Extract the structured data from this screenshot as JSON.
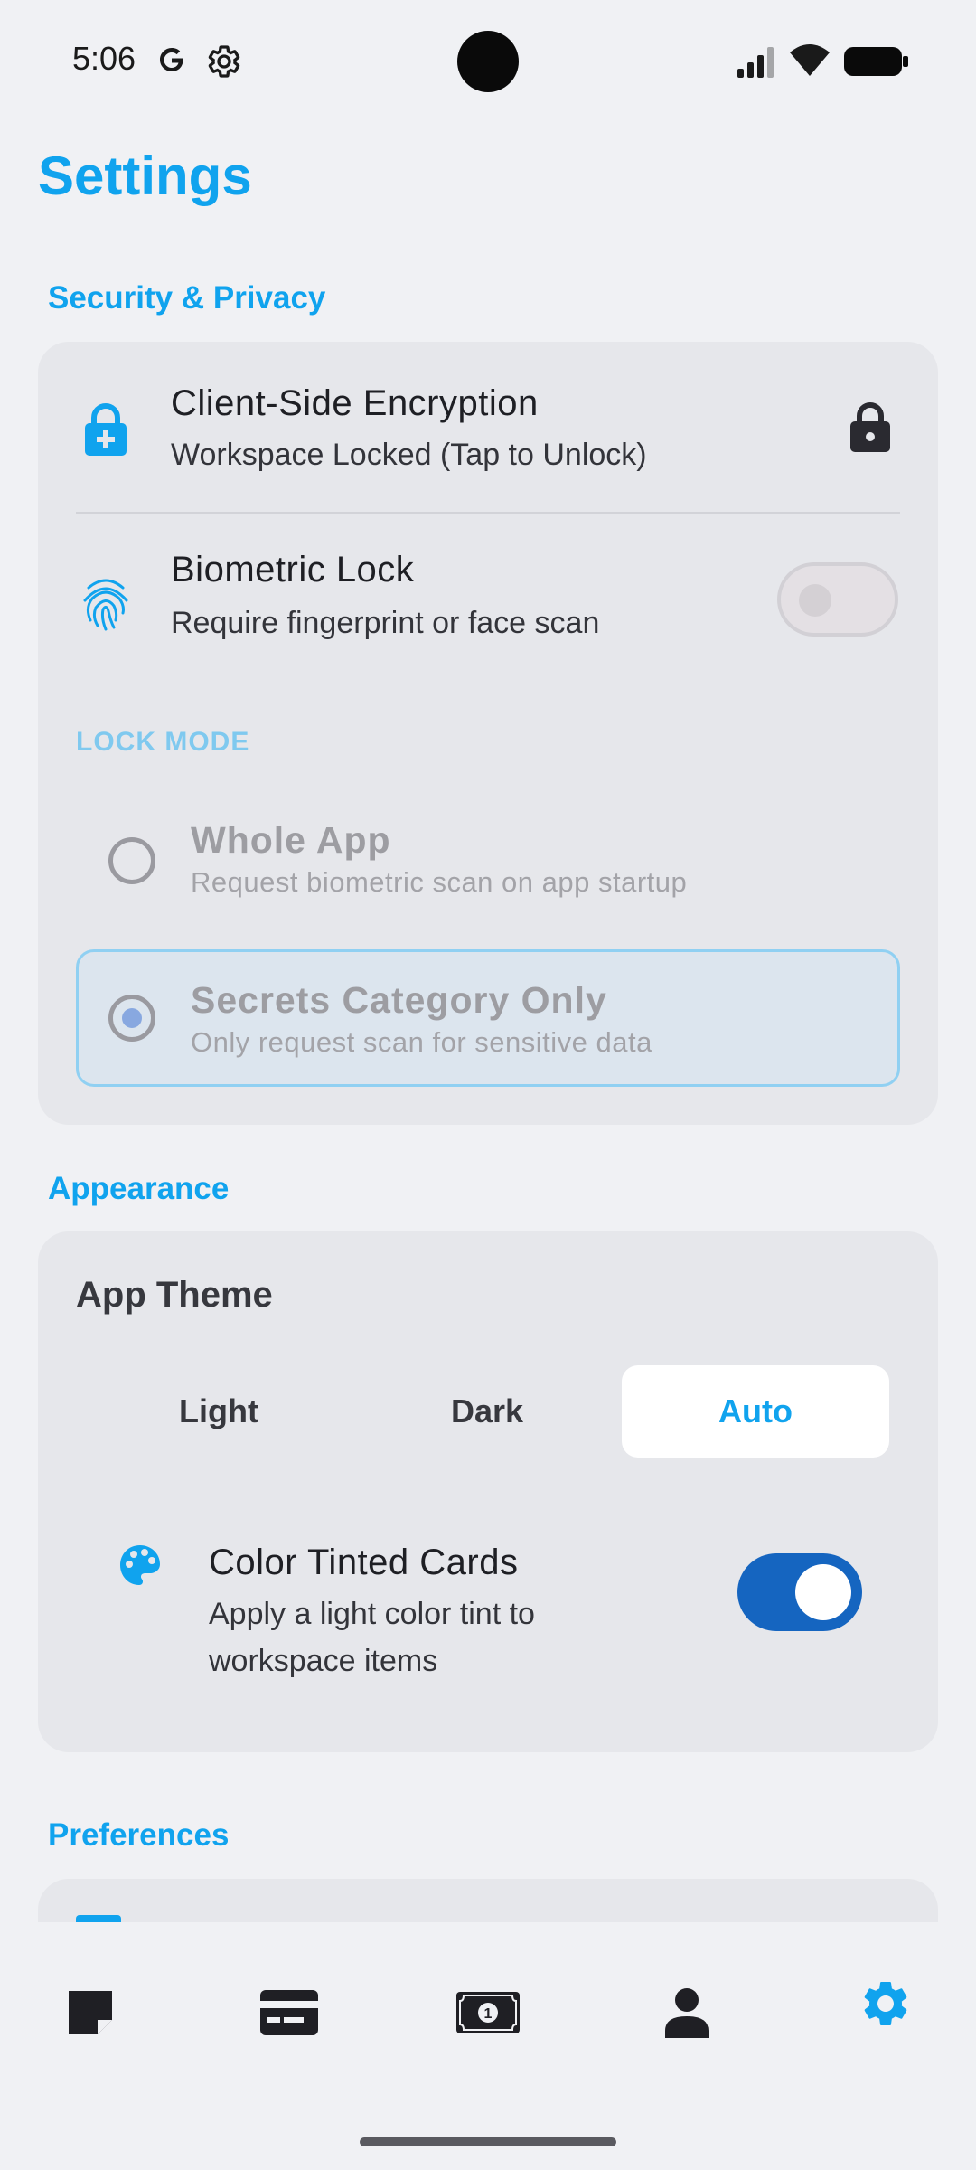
{
  "status_bar": {
    "time": "5:06",
    "icons": [
      "google-icon",
      "settings-gear-icon",
      "signal-icon",
      "wifi-icon",
      "battery-icon"
    ]
  },
  "page": {
    "title": "Settings"
  },
  "sections": {
    "security": {
      "title": "Security & Privacy",
      "encryption": {
        "title": "Client-Side Encryption",
        "subtitle": "Workspace Locked (Tap to Unlock)",
        "icon": "lock-plus-icon",
        "trailing_icon": "lock-icon"
      },
      "biometric": {
        "title": "Biometric Lock",
        "subtitle": "Require fingerprint or face scan",
        "icon": "fingerprint-icon",
        "enabled": false
      },
      "lock_mode": {
        "label": "LOCK MODE",
        "options": [
          {
            "title": "Whole App",
            "subtitle": "Request biometric scan on app startup",
            "selected": false
          },
          {
            "title": "Secrets Category Only",
            "subtitle": "Only request scan for sensitive data",
            "selected": true
          }
        ]
      }
    },
    "appearance": {
      "title": "Appearance",
      "app_theme": {
        "label": "App Theme",
        "options": [
          "Light",
          "Dark",
          "Auto"
        ],
        "selected": "Auto"
      },
      "tinted_cards": {
        "title": "Color Tinted Cards",
        "subtitle_line1": "Apply a light color tint to",
        "subtitle_line2": "workspace items",
        "icon": "palette-icon",
        "enabled": true
      }
    },
    "preferences": {
      "title": "Preferences"
    }
  },
  "bottom_nav": {
    "items": [
      "notes-icon",
      "credit-card-icon",
      "money-icon",
      "person-icon",
      "settings-icon"
    ],
    "active": "settings-icon"
  },
  "colors": {
    "accent": "#10a3ee",
    "toggle_on": "#1565c0",
    "background": "#f0f1f4",
    "card": "#e6e7eb"
  }
}
